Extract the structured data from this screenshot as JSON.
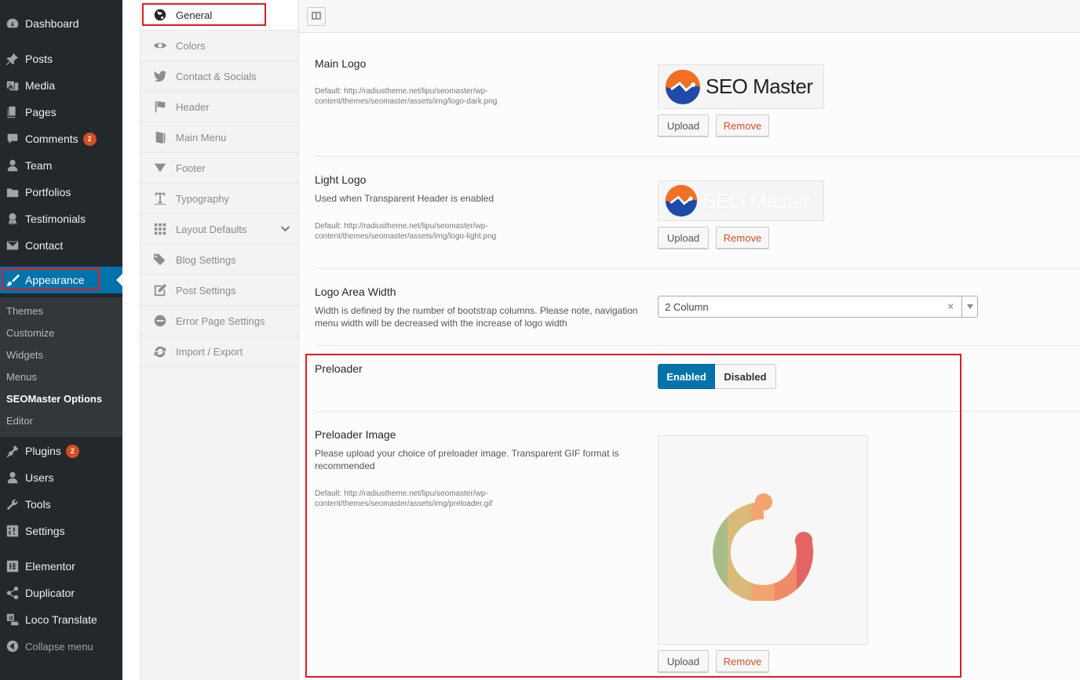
{
  "admin_menu": {
    "items": [
      {
        "label": "Dashboard",
        "icon": "dashboard-icon"
      },
      {
        "label": "Posts",
        "icon": "pin-icon"
      },
      {
        "label": "Media",
        "icon": "media-icon"
      },
      {
        "label": "Pages",
        "icon": "pages-icon"
      },
      {
        "label": "Comments",
        "icon": "comments-icon",
        "badge": "2"
      },
      {
        "label": "Team",
        "icon": "user-icon"
      },
      {
        "label": "Portfolios",
        "icon": "folder-icon"
      },
      {
        "label": "Testimonials",
        "icon": "award-icon"
      },
      {
        "label": "Contact",
        "icon": "mail-icon"
      },
      {
        "label": "Appearance",
        "icon": "brush-icon",
        "active": true
      },
      {
        "label": "Plugins",
        "icon": "plugin-icon",
        "badge": "2"
      },
      {
        "label": "Users",
        "icon": "users-icon"
      },
      {
        "label": "Tools",
        "icon": "wrench-icon"
      },
      {
        "label": "Settings",
        "icon": "settings-icon"
      },
      {
        "label": "Elementor",
        "icon": "elementor-icon"
      },
      {
        "label": "Duplicator",
        "icon": "share-icon"
      },
      {
        "label": "Loco Translate",
        "icon": "translate-icon"
      },
      {
        "label": "Collapse menu",
        "icon": "collapse-icon"
      }
    ],
    "submenu": [
      "Themes",
      "Customize",
      "Widgets",
      "Menus",
      "SEOMaster Options",
      "Editor"
    ],
    "submenu_current": "SEOMaster Options",
    "active_color": "#0073aa",
    "badge_color": "#d54e21"
  },
  "options_nav": {
    "items": [
      {
        "label": "General",
        "icon": "globe-icon",
        "current": true
      },
      {
        "label": "Colors",
        "icon": "eye-icon"
      },
      {
        "label": "Contact & Socials",
        "icon": "twitter-icon"
      },
      {
        "label": "Header",
        "icon": "flag-icon"
      },
      {
        "label": "Main Menu",
        "icon": "book-icon"
      },
      {
        "label": "Footer",
        "icon": "triangle-down-icon"
      },
      {
        "label": "Typography",
        "icon": "text-icon"
      },
      {
        "label": "Layout Defaults",
        "icon": "grid-icon"
      },
      {
        "label": "Blog Settings",
        "icon": "tags-icon"
      },
      {
        "label": "Post Settings",
        "icon": "edit-icon"
      },
      {
        "label": "Error Page Settings",
        "icon": "minus-circle-icon"
      },
      {
        "label": "Import / Export",
        "icon": "refresh-icon"
      }
    ]
  },
  "fields": {
    "main_logo": {
      "title": "Main Logo",
      "default": "Default: http://radiustheme.net/lipu/seomaster/wp-content/themes/seomaster/assets/img/logo-dark.png",
      "logo_text": "SEO Master",
      "upload": "Upload",
      "remove": "Remove"
    },
    "light_logo": {
      "title": "Light Logo",
      "subtitle": "Used when Transparent Header is enabled",
      "default": "Default: http://radiustheme.net/lipu/seomaster/wp-content/themes/seomaster/assets/img/logo-light.png",
      "logo_text": "SEO Master",
      "upload": "Upload",
      "remove": "Remove"
    },
    "logo_width": {
      "title": "Logo Area Width",
      "subtitle": "Width is defined by the number of bootstrap columns. Please note, navigation menu width will be decreased with the increase of logo width",
      "value": "2 Column",
      "clear": "×"
    },
    "preloader": {
      "title": "Preloader",
      "enabled": "Enabled",
      "disabled": "Disabled",
      "state": "Enabled"
    },
    "preloader_image": {
      "title": "Preloader Image",
      "subtitle": "Please upload your choice of preloader image. Transparent GIF format is recommended",
      "default": "Default: http://radiustheme.net/lipu/seomaster/wp-content/themes/seomaster/assets/img/preloader.gif",
      "upload": "Upload",
      "remove": "Remove"
    }
  },
  "colors": {
    "highlight": "#e21b23",
    "logo_orange": "#f36f21",
    "logo_blue": "#1e4aa8"
  }
}
